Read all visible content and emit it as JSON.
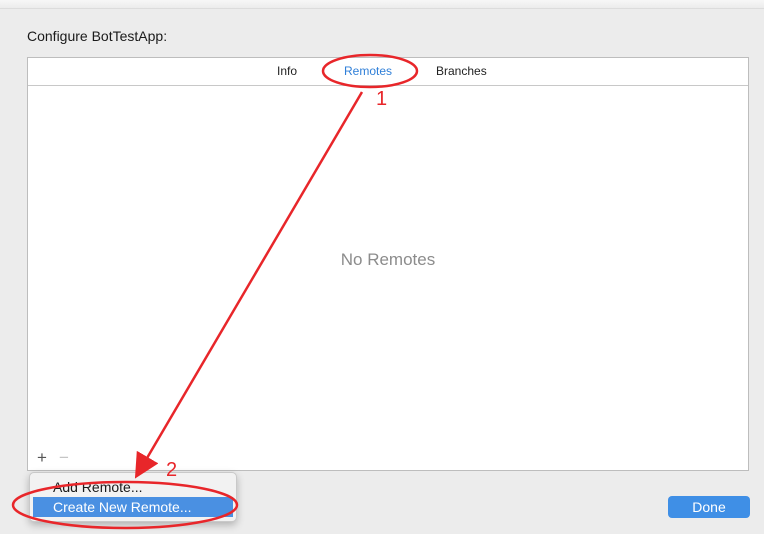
{
  "dialog": {
    "title": "Configure BotTestApp:"
  },
  "tabs": [
    {
      "label": "Info",
      "active": false
    },
    {
      "label": "Remotes",
      "active": true
    },
    {
      "label": "Branches",
      "active": false
    }
  ],
  "remotes_list": {
    "empty_text": "No Remotes"
  },
  "toolbar": {
    "add_label": "+",
    "remove_label": "−"
  },
  "menu": {
    "items": [
      {
        "label": "Add Remote...",
        "selected": false
      },
      {
        "label": "Create New Remote...",
        "selected": true
      }
    ]
  },
  "footer": {
    "done_label": "Done"
  },
  "annotations": {
    "step1": "1",
    "step2": "2",
    "color": "#e8262a"
  },
  "colors": {
    "accent": "#2f7fd8",
    "menu_highlight": "#4a90e2",
    "done_button": "#3f8fe6"
  }
}
